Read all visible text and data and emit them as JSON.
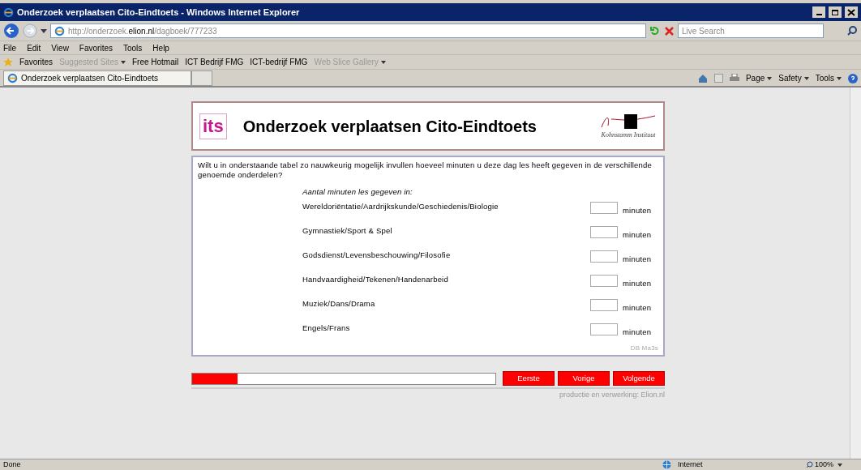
{
  "window": {
    "title": "Onderzoek verplaatsen Cito-Eindtoets - Windows Internet Explorer"
  },
  "address_bar": {
    "url_prefix": "http://onderzoek.",
    "url_domain": "elion.nl",
    "url_path": "/dagboek/777233"
  },
  "search": {
    "placeholder": "Live Search"
  },
  "menu": [
    "File",
    "Edit",
    "View",
    "Favorites",
    "Tools",
    "Help"
  ],
  "favorites_bar": [
    {
      "label": "Favorites",
      "kind": "star"
    },
    {
      "label": "Suggested Sites",
      "kind": "dim-dropdown"
    },
    {
      "label": "Free Hotmail",
      "kind": "link"
    },
    {
      "label": "ICT Bedrijf FMG",
      "kind": "link"
    },
    {
      "label": "ICT-bedrijf FMG",
      "kind": "link"
    },
    {
      "label": "Web Slice Gallery",
      "kind": "dim-dropdown"
    }
  ],
  "tab": {
    "title": "Onderzoek verplaatsen Cito-Eindtoets"
  },
  "command_bar": [
    "Page",
    "Safety",
    "Tools"
  ],
  "page": {
    "logo": "its",
    "heading": "Onderzoek verplaatsen Cito-Eindtoets",
    "institute": "Kohnstamm Instituut",
    "question": "Wilt u in onderstaande tabel zo nauwkeurig mogelijk invullen hoeveel minuten u deze dag les heeft gegeven in de verschillende genoemde onderdelen?",
    "subheading": "Aantal minuten les gegeven in:",
    "rows": [
      {
        "label": "Wereldoriëntatie/Aardrijkskunde/Geschiedenis/Biologie",
        "unit": "minuten"
      },
      {
        "label": "Gymnastiek/Sport & Spel",
        "unit": "minuten"
      },
      {
        "label": "Godsdienst/Levensbeschouwing/Filosofie",
        "unit": "minuten"
      },
      {
        "label": "Handvaardigheid/Tekenen/Handenarbeid",
        "unit": "minuten"
      },
      {
        "label": "Muziek/Dans/Drama",
        "unit": "minuten"
      },
      {
        "label": "Engels/Frans",
        "unit": "minuten"
      }
    ],
    "code": "DB Ma3s",
    "progress": {
      "level": 0.15
    },
    "buttons": [
      "Eerste",
      "Vorige",
      "Volgende"
    ],
    "credits": "productie en verwerking: Elion.nl"
  },
  "status_bar": {
    "text": "Done",
    "zone": "Internet",
    "zoom": "100%"
  }
}
